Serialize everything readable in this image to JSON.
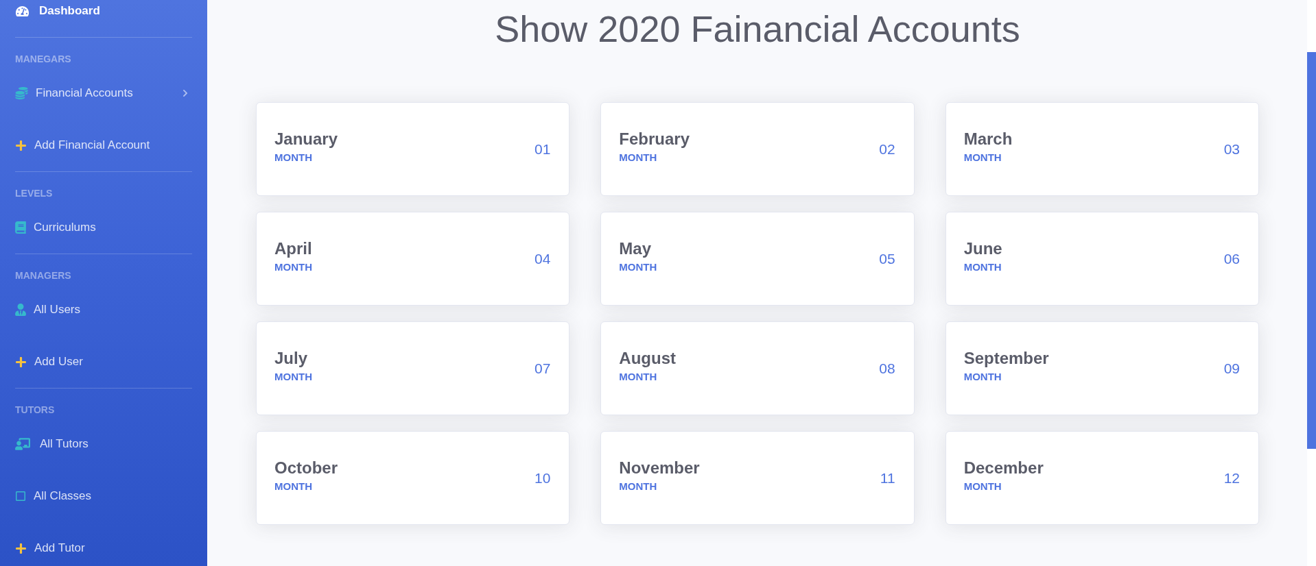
{
  "sidebar": {
    "dashboard": {
      "label": "Dashboard",
      "selected": true
    },
    "sections": [
      {
        "heading": "MANEGARS",
        "items": [
          {
            "label": "Financial Accounts",
            "kind": "collapse",
            "expanded": false,
            "selected": false
          },
          {
            "label": "Add Financial Account",
            "kind": "link",
            "selected": false
          }
        ]
      },
      {
        "heading": "LEVELS",
        "items": [
          {
            "label": "Curriculums",
            "kind": "link",
            "selected": false
          }
        ]
      },
      {
        "heading": "MANAGERS",
        "items": [
          {
            "label": "All Users",
            "kind": "link",
            "selected": false
          },
          {
            "label": "Add User",
            "kind": "link",
            "selected": false
          }
        ]
      },
      {
        "heading": "TUTORS",
        "items": [
          {
            "label": "All Tutors",
            "kind": "link",
            "selected": false
          },
          {
            "label": "All Classes",
            "kind": "link",
            "selected": false
          },
          {
            "label": "Add Tutor",
            "kind": "link",
            "selected": false
          }
        ]
      }
    ]
  },
  "main": {
    "title": "Show 2020 Fainancial Accounts",
    "months": [
      {
        "name": "January",
        "label": "MONTH",
        "number": "01"
      },
      {
        "name": "February",
        "label": "MONTH",
        "number": "02"
      },
      {
        "name": "March",
        "label": "MONTH",
        "number": "03"
      },
      {
        "name": "April",
        "label": "MONTH",
        "number": "04"
      },
      {
        "name": "May",
        "label": "MONTH",
        "number": "05"
      },
      {
        "name": "June",
        "label": "MONTH",
        "number": "06"
      },
      {
        "name": "July",
        "label": "MONTH",
        "number": "07"
      },
      {
        "name": "August",
        "label": "MONTH",
        "number": "08"
      },
      {
        "name": "September",
        "label": "MONTH",
        "number": "09"
      },
      {
        "name": "October",
        "label": "MONTH",
        "number": "10"
      },
      {
        "name": "November",
        "label": "MONTH",
        "number": "11"
      },
      {
        "name": "December",
        "label": "MONTH",
        "number": "12"
      }
    ]
  }
}
